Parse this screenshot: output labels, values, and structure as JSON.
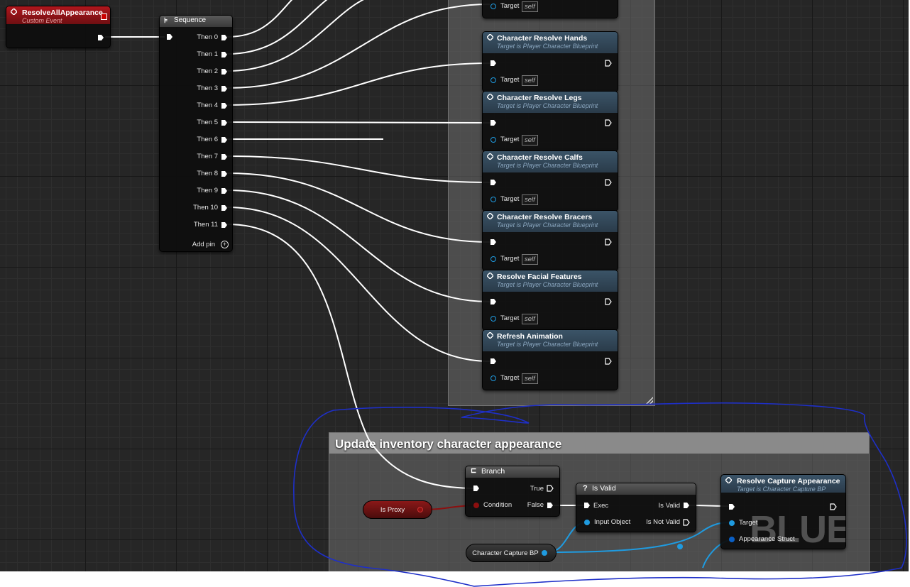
{
  "custom_event": {
    "title": "ResolveAllAppearance",
    "subtitle": "Custom Event"
  },
  "sequence": {
    "title": "Sequence",
    "outputs": [
      "Then 0",
      "Then 1",
      "Then 2",
      "Then 3",
      "Then 4",
      "Then 5",
      "Then 6",
      "Then 7",
      "Then 8",
      "Then 9",
      "Then 10",
      "Then 11"
    ],
    "add_pin": "Add pin"
  },
  "function_nodes": [
    {
      "title": "",
      "subtitle": "",
      "target_label": "Target",
      "target_value": "self"
    },
    {
      "title": "Character Resolve Hands",
      "subtitle": "Target is Player Character Blueprint",
      "target_label": "Target",
      "target_value": "self"
    },
    {
      "title": "Character Resolve Legs",
      "subtitle": "Target is Player Character Blueprint",
      "target_label": "Target",
      "target_value": "self"
    },
    {
      "title": "Character Resolve Calfs",
      "subtitle": "Target is Player Character Blueprint",
      "target_label": "Target",
      "target_value": "self"
    },
    {
      "title": "Character Resolve Bracers",
      "subtitle": "Target is Player Character Blueprint",
      "target_label": "Target",
      "target_value": "self"
    },
    {
      "title": "Resolve Facial Features",
      "subtitle": "Target is Player Character Blueprint",
      "target_label": "Target",
      "target_value": "self"
    },
    {
      "title": "Refresh Animation",
      "subtitle": "Target is Player Character Blueprint",
      "target_label": "Target",
      "target_value": "self"
    }
  ],
  "comment": {
    "title": "Update inventory character appearance"
  },
  "branch": {
    "title": "Branch",
    "true_label": "True",
    "false_label": "False",
    "condition_label": "Condition"
  },
  "is_valid": {
    "title": "Is Valid",
    "exec_label": "Exec",
    "input_label": "Input Object",
    "valid_label": "Is Valid",
    "not_valid_label": "Is Not Valid"
  },
  "resolve_capture": {
    "title": "Resolve Capture Appearance",
    "subtitle": "Target is Character Capture BP",
    "target_label": "Target",
    "struct_label": "Appearance Struct"
  },
  "variables": {
    "is_proxy": "Is Proxy",
    "character_capture": "Character Capture BP"
  },
  "watermark": "BLUEPR",
  "colors": {
    "exec_wire": "#ffffff",
    "bool_pin": "#8c0f0f",
    "object_pin": "#1f9be0",
    "struct_pin": "#0a5fc4",
    "annotation": "#1e2fc8"
  }
}
